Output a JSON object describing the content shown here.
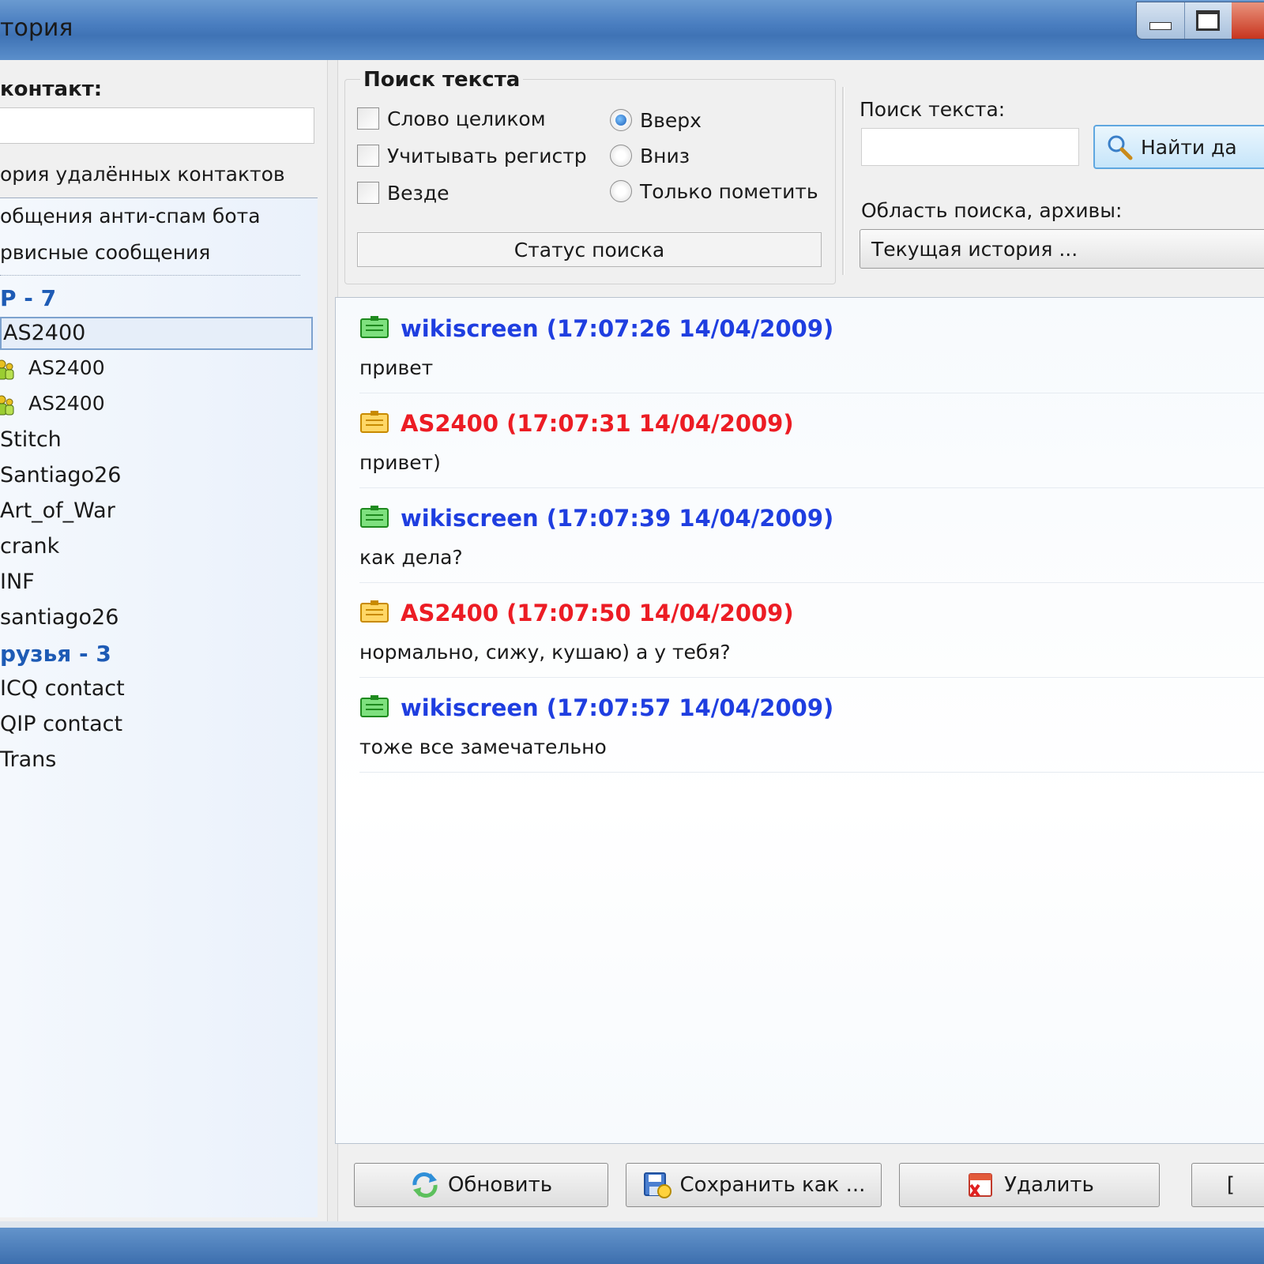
{
  "window": {
    "title": "тория"
  },
  "left": {
    "contact_label": "контакт:",
    "contact_input_value": "",
    "deleted_history": "ория удалённых контактов",
    "special_items": [
      "общения анти-спам бота",
      "рвисные сообщения"
    ],
    "group1": "P - 7",
    "selected_contact": "AS2400",
    "sub_contacts": [
      "AS2400",
      "AS2400"
    ],
    "contacts_group1": [
      "Stitch",
      "Santiago26",
      "Art_of_War",
      "crank",
      "INF",
      "santiago26"
    ],
    "group2": "рузья - 3",
    "contacts_group2": [
      "ICQ contact",
      "QIP contact",
      "Trans"
    ]
  },
  "search": {
    "group_title": "Поиск текста",
    "whole_word": "Слово целиком",
    "match_case": "Учитывать регистр",
    "everywhere": "Везде",
    "dir_up": "Вверх",
    "dir_down": "Вниз",
    "mark_only": "Только пометить",
    "status": "Статус поиска",
    "text_label": "Поиск текста:",
    "text_value": "",
    "find_button": "Найти да",
    "scope_label": "Область поиска, архивы:",
    "scope_value": "Текущая история ..."
  },
  "messages": [
    {
      "header": "wikiscreen (17:07:26 14/04/2009)",
      "text": "привет",
      "sender": "self"
    },
    {
      "header": "AS2400 (17:07:31 14/04/2009)",
      "text": "привет)",
      "sender": "other"
    },
    {
      "header": "wikiscreen (17:07:39 14/04/2009)",
      "text": "как дела?",
      "sender": "self"
    },
    {
      "header": "AS2400 (17:07:50 14/04/2009)",
      "text": "нормально, сижу, кушаю) а у тебя?",
      "sender": "other"
    },
    {
      "header": "wikiscreen (17:07:57 14/04/2009)",
      "text": "тоже все замечательно",
      "sender": "self"
    }
  ],
  "buttons": {
    "refresh": "Обновить",
    "save_as": "Сохранить как ...",
    "delete": "Удалить",
    "extra": "["
  },
  "colors": {
    "self": "#1f3ee0",
    "other": "#ec1c24",
    "group": "#1e5bb5"
  }
}
